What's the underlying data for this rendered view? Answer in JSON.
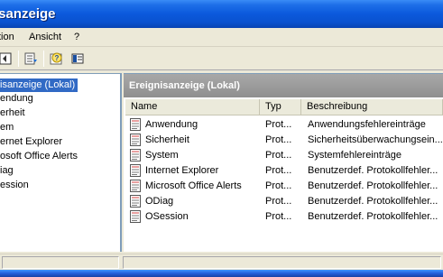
{
  "window": {
    "title": "isanzeige"
  },
  "menu": {
    "items": [
      "tion",
      "Ansicht",
      "?"
    ]
  },
  "toolbar": {
    "icons": [
      "back-arrow-icon",
      "show-hide-tree-icon",
      "export-list-icon",
      "help-icon",
      "properties-icon"
    ]
  },
  "tree": {
    "items": [
      {
        "label": "isanzeige (Lokal)",
        "selected": true
      },
      {
        "label": "endung"
      },
      {
        "label": "erheit"
      },
      {
        "label": "em"
      },
      {
        "label": "ernet Explorer"
      },
      {
        "label": "osoft Office Alerts"
      },
      {
        "label": "iag"
      },
      {
        "label": "ession"
      }
    ]
  },
  "main": {
    "header": "Ereignisanzeige (Lokal)",
    "columns": [
      "Name",
      "Typ",
      "Beschreibung"
    ],
    "rows": [
      {
        "name": "Anwendung",
        "typ": "Prot...",
        "beschreibung": "Anwendungsfehlereinträge"
      },
      {
        "name": "Sicherheit",
        "typ": "Prot...",
        "beschreibung": "Sicherheitsüberwachungsein..."
      },
      {
        "name": "System",
        "typ": "Prot...",
        "beschreibung": "Systemfehlereinträge"
      },
      {
        "name": "Internet Explorer",
        "typ": "Prot...",
        "beschreibung": "Benutzerdef. Protokollfehler..."
      },
      {
        "name": "Microsoft Office Alerts",
        "typ": "Prot...",
        "beschreibung": "Benutzerdef. Protokollfehler..."
      },
      {
        "name": "ODiag",
        "typ": "Prot...",
        "beschreibung": "Benutzerdef. Protokollfehler..."
      },
      {
        "name": "OSession",
        "typ": "Prot...",
        "beschreibung": "Benutzerdef. Protokollfehler..."
      }
    ]
  },
  "colors": {
    "title_bar": "#0b59dc",
    "selection": "#316ac5",
    "pane_header": "#8f8f8f"
  }
}
